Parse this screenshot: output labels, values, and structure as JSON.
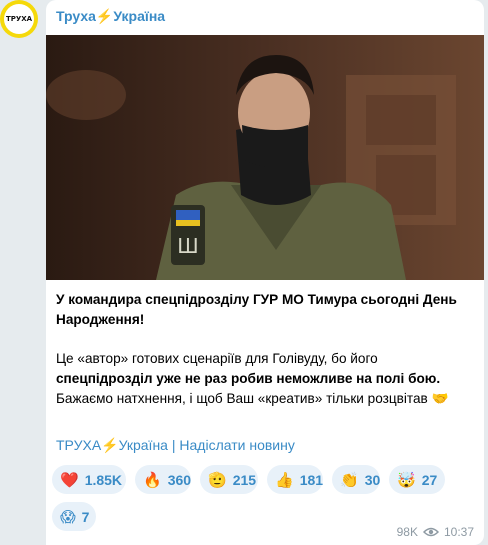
{
  "avatar": {
    "text": "ТРУХА",
    "bg": "#f5d90a"
  },
  "channel": {
    "name_part1": "Труха",
    "bolt": "⚡",
    "name_part2": "Україна"
  },
  "post": {
    "p1": "У командира спецпідрозділу ГУР МО Тимура сьогодні День Народження!",
    "p2_a": "Це «автор» готових сценаріїв для Голівуду, бо його ",
    "p2_b": "спецпідрозділ уже не раз робив неможливе на полі бою.",
    "p2_c": " Бажаємо натхнення, і щоб Ваш «креатив» тільки розцвітав 🤝"
  },
  "links": {
    "channel_a": "ТРУХА",
    "bolt": "⚡",
    "channel_b": "Україна",
    "separator": " | ",
    "submit": "Надіслати новину"
  },
  "reactions": [
    {
      "emoji": "❤️",
      "count": "1.85K"
    },
    {
      "emoji": "🔥",
      "count": "360"
    },
    {
      "emoji": "🫡",
      "count": "215"
    },
    {
      "emoji": "👍",
      "count": "181"
    },
    {
      "emoji": "👏",
      "count": "30"
    },
    {
      "emoji": "🤯",
      "count": "27"
    },
    {
      "emoji": "😱",
      "count": "7"
    }
  ],
  "meta": {
    "views": "98K",
    "time": "10:37"
  },
  "colors": {
    "accent": "#3a8bc6",
    "reaction_bg": "#e8f1f9",
    "meta": "#8e9aa3"
  }
}
